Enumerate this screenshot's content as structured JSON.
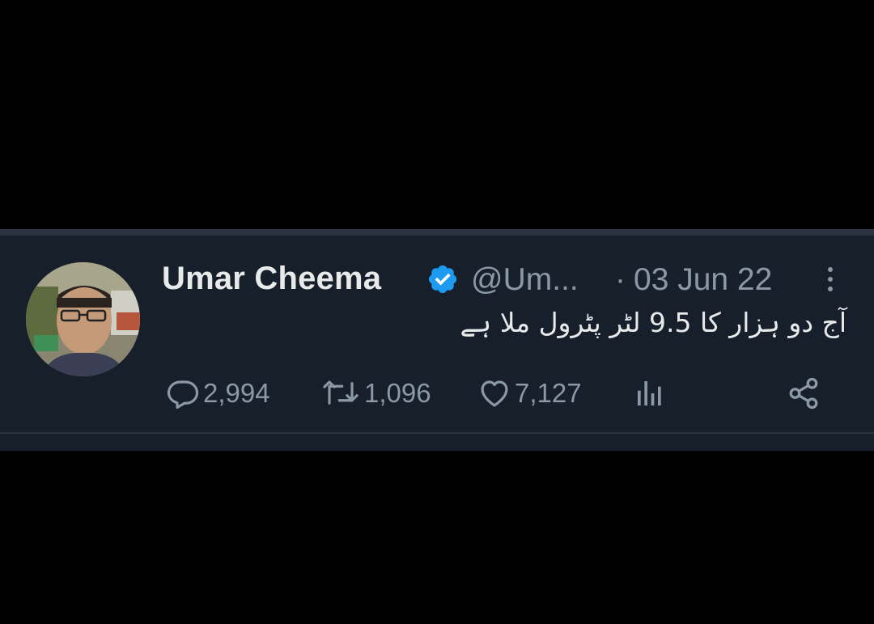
{
  "tweet": {
    "author_name": "Umar Cheema",
    "handle": "@Um...",
    "separator": "·",
    "timestamp": "03 Jun 22",
    "verified": true,
    "text": "آج دو ہزار کا 9.5 لٹر پٹرول ملا ہے"
  },
  "actions": {
    "replies": "2,994",
    "retweets": "1,096",
    "likes": "7,127"
  },
  "icons": {
    "verified": "verified-badge-icon",
    "more": "more-vertical-icon",
    "reply": "reply-icon",
    "retweet": "retweet-icon",
    "like": "heart-icon",
    "views": "analytics-icon",
    "share": "share-icon"
  },
  "colors": {
    "background": "#000000",
    "card": "#17202a",
    "text_primary": "#e7e9ea",
    "text_secondary": "#8b98a5",
    "verified_blue": "#1d9bf0"
  }
}
